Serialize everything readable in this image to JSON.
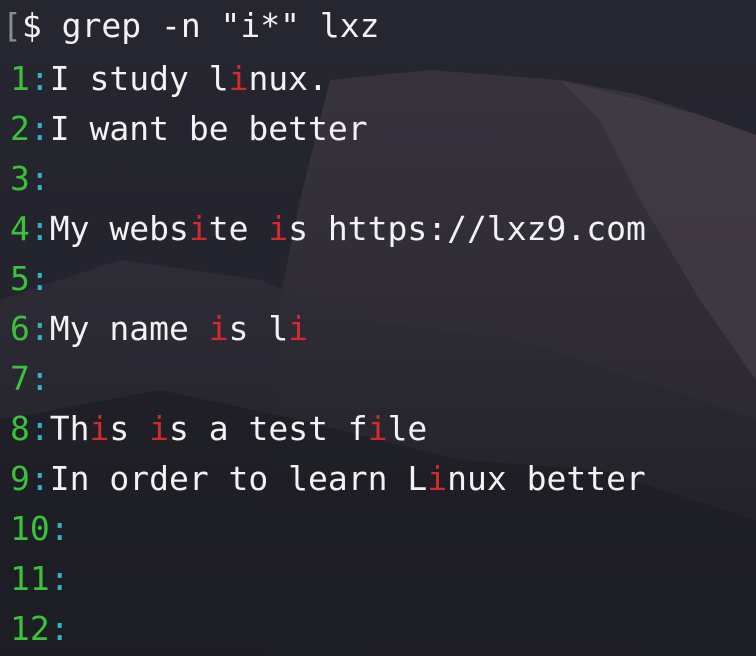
{
  "terminal": {
    "bracket": "[",
    "prompt": "$",
    "command": " grep -n \"i*\" lxz",
    "match_color": "#d42a2a",
    "line_number_color": "#39c23a",
    "separator_color": "#2eb6c6",
    "text_color": "#f2f2f2",
    "results": [
      {
        "num": "1",
        "sep": ":",
        "segs": [
          {
            "t": "I study l"
          },
          {
            "t": "i",
            "m": true
          },
          {
            "t": "nux."
          }
        ]
      },
      {
        "num": "2",
        "sep": ":",
        "segs": [
          {
            "t": "I want be better"
          }
        ]
      },
      {
        "num": "3",
        "sep": ":",
        "segs": []
      },
      {
        "num": "4",
        "sep": ":",
        "segs": [
          {
            "t": "My webs"
          },
          {
            "t": "i",
            "m": true
          },
          {
            "t": "te "
          },
          {
            "t": "i",
            "m": true
          },
          {
            "t": "s https://lxz9.com"
          }
        ]
      },
      {
        "num": "5",
        "sep": ":",
        "segs": []
      },
      {
        "num": "6",
        "sep": ":",
        "segs": [
          {
            "t": "My name "
          },
          {
            "t": "i",
            "m": true
          },
          {
            "t": "s l"
          },
          {
            "t": "i",
            "m": true
          }
        ]
      },
      {
        "num": "7",
        "sep": ":",
        "segs": []
      },
      {
        "num": "8",
        "sep": ":",
        "segs": [
          {
            "t": "Th"
          },
          {
            "t": "i",
            "m": true
          },
          {
            "t": "s "
          },
          {
            "t": "i",
            "m": true
          },
          {
            "t": "s a test f"
          },
          {
            "t": "i",
            "m": true
          },
          {
            "t": "le"
          }
        ]
      },
      {
        "num": "9",
        "sep": ":",
        "segs": [
          {
            "t": "In order to learn L"
          },
          {
            "t": "i",
            "m": true
          },
          {
            "t": "nux better"
          }
        ]
      },
      {
        "num": "10",
        "sep": ":",
        "segs": []
      },
      {
        "num": "11",
        "sep": ":",
        "segs": []
      },
      {
        "num": "12",
        "sep": ":",
        "segs": []
      }
    ]
  }
}
